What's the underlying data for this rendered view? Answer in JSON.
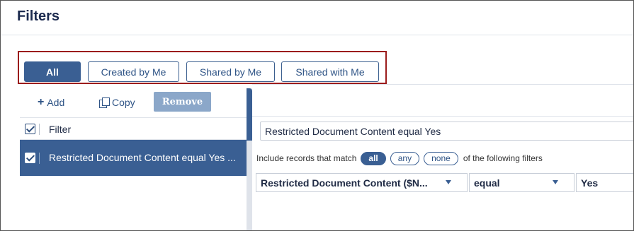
{
  "header": {
    "title": "Filters"
  },
  "tabs": [
    {
      "label": "All",
      "active": true
    },
    {
      "label": "Created by Me",
      "active": false
    },
    {
      "label": "Shared by Me",
      "active": false
    },
    {
      "label": "Shared with Me",
      "active": false
    }
  ],
  "toolbar": {
    "add_label": "Add",
    "copy_label": "Copy",
    "remove_label": "Remove"
  },
  "list": {
    "column_header": "Filter",
    "header_checked": true,
    "rows": [
      {
        "label": "Restricted Document Content equal Yes ...",
        "checked": true,
        "selected": true
      }
    ]
  },
  "editor": {
    "expression": "Restricted Document Content equal Yes",
    "match_prefix": "Include records that match",
    "match_options": [
      "all",
      "any",
      "none"
    ],
    "match_selected": "all",
    "match_suffix": "of the following filters",
    "condition": {
      "field": "Restricted Document Content ($N...",
      "operator": "equal",
      "value": "Yes"
    }
  },
  "colors": {
    "accent": "#3a5f93",
    "highlight_border": "#9b1c1c",
    "disabled_button": "#8ba7c9"
  }
}
